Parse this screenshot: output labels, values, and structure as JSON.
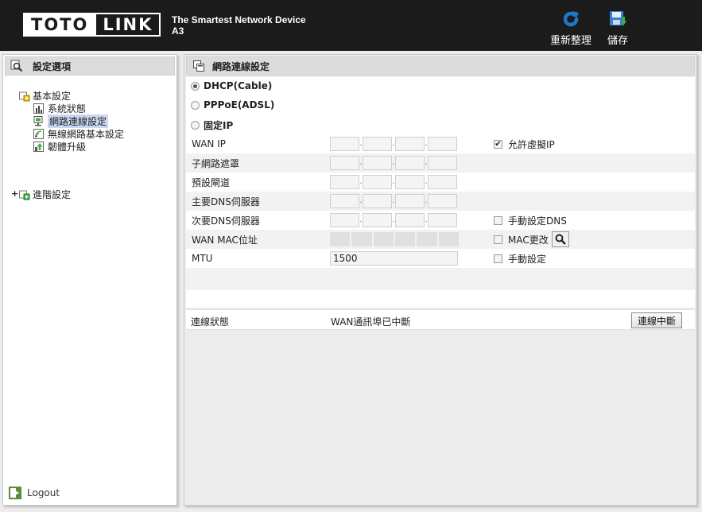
{
  "header": {
    "logo_left": "TOTO",
    "logo_right": "LINK",
    "tagline": "The Smartest Network Device",
    "model": "A3",
    "refresh_label": "重新整理",
    "save_label": "儲存"
  },
  "sidebar": {
    "title": "設定選項",
    "basic_label": "基本設定",
    "items": [
      {
        "label": "系統狀態",
        "icon": "chart-icon"
      },
      {
        "label": "網路連線設定",
        "icon": "network-icon",
        "selected": true
      },
      {
        "label": "無線網路基本設定",
        "icon": "wireless-icon"
      },
      {
        "label": "韌體升級",
        "icon": "upgrade-icon"
      }
    ],
    "advanced_label": "進階設定",
    "expander": "+",
    "logout_label": "Logout"
  },
  "main": {
    "title": "網路連線設定",
    "modes": [
      {
        "label": "DHCP(Cable)",
        "selected": true
      },
      {
        "label": "PPPoE(ADSL)",
        "selected": false
      },
      {
        "label": "固定IP",
        "selected": false
      }
    ],
    "fields": {
      "wan_ip": "WAN IP",
      "subnet": "子網路遮罩",
      "gateway": "預設閘道",
      "dns1": "主要DNS伺服器",
      "dns2": "次要DNS伺服器",
      "wan_mac": "WAN MAC位址",
      "mtu": "MTU",
      "mtu_value": "1500"
    },
    "options": {
      "virtual_ip": "允許虛擬IP",
      "manual_dns": "手動設定DNS",
      "mac_change": "MAC更改",
      "manual_mtu": "手動設定"
    },
    "status": {
      "label": "連線狀態",
      "value": "WAN通訊埠已中斷",
      "button": "連線中斷"
    }
  },
  "colors": {
    "header_bg": "#1b1b1b",
    "panel_header": "#dcdcdc",
    "selected_bg": "#c9d7ef",
    "refresh_icon": "#1e78c8"
  }
}
